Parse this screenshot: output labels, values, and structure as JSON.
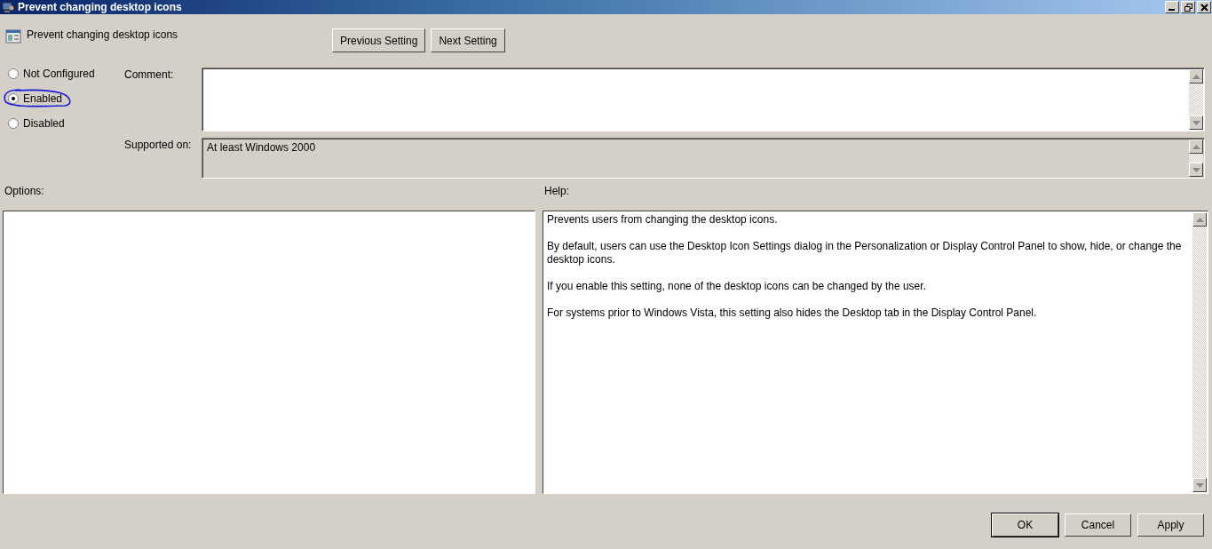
{
  "window": {
    "title": "Prevent changing desktop icons"
  },
  "header": {
    "title": "Prevent changing desktop icons"
  },
  "nav_buttons": [
    "Previous Setting",
    "Next Setting"
  ],
  "state_options": [
    {
      "label": "Not Configured",
      "selected": false,
      "circled": false
    },
    {
      "label": "Enabled",
      "selected": true,
      "circled": true
    },
    {
      "label": "Disabled",
      "selected": false,
      "circled": false
    }
  ],
  "comment": {
    "label": "Comment:"
  },
  "supported_on": {
    "label": "Supported on:",
    "value": "At least Windows 2000"
  },
  "options": {
    "label": "Options:"
  },
  "help": {
    "label": "Help:",
    "paragraphs": [
      "Prevents users from changing the desktop icons.",
      "By default, users can use the Desktop Icon Settings dialog in the Personalization or Display Control Panel to show, hide, or change the desktop icons.",
      "If you enable this setting, none of the desktop icons can be changed by the user.",
      "For systems prior to Windows Vista, this setting also hides the Desktop tab in the Display Control Panel."
    ]
  },
  "buttons": [
    {
      "label": "OK",
      "default": true
    },
    {
      "label": "Cancel",
      "default": false
    },
    {
      "label": "Apply",
      "default": false
    }
  ]
}
